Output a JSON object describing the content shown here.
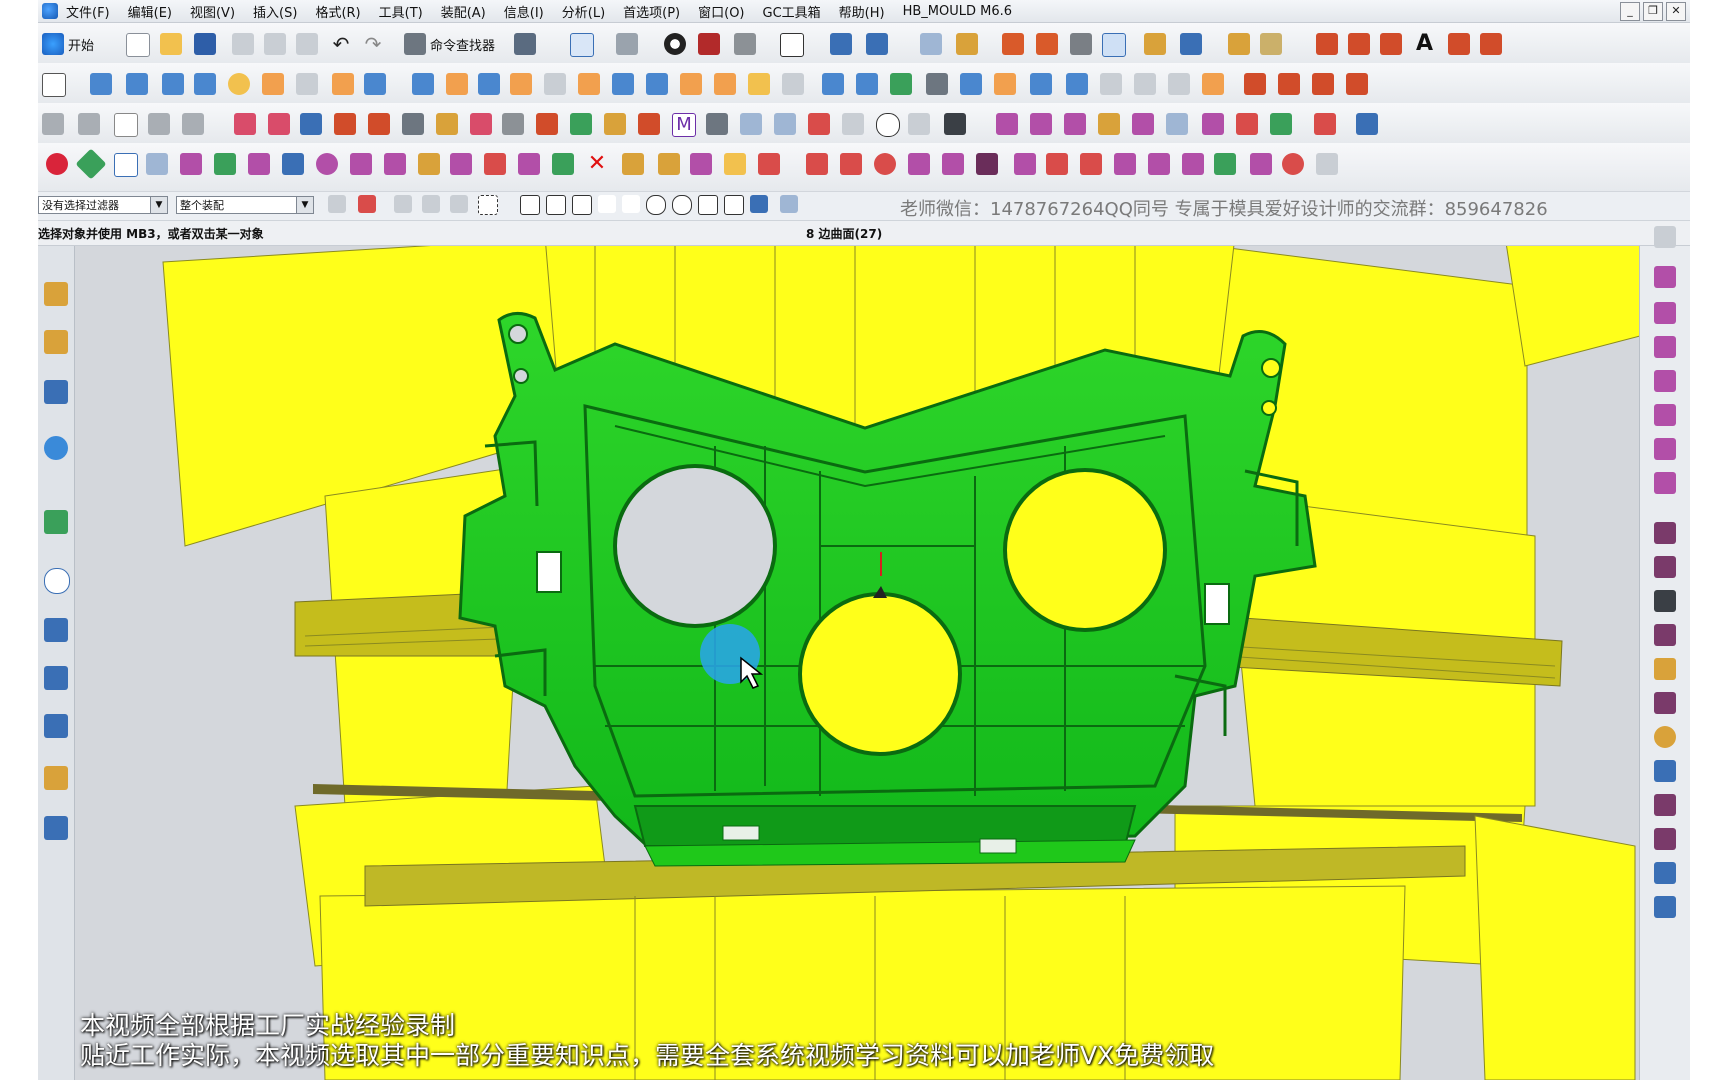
{
  "menubar": {
    "items": [
      "文件(F)",
      "编辑(E)",
      "视图(V)",
      "插入(S)",
      "格式(R)",
      "工具(T)",
      "装配(A)",
      "信息(I)",
      "分析(L)",
      "首选项(P)",
      "窗口(O)",
      "GC工具箱",
      "帮助(H)",
      "HB_MOULD M6.6"
    ]
  },
  "window_controls": {
    "minimize": "_",
    "restore": "❐",
    "close": "✕"
  },
  "toolbar": {
    "start_label": "开始",
    "command_finder_label": "命令查找器",
    "text_tool": "A"
  },
  "selection_bar": {
    "filter_value": "没有选择过滤器",
    "scope_value": "整个装配",
    "banner_text": "老师微信：1478767264QQ同号 专属于模具爱好设计师的交流群：859647826"
  },
  "status": {
    "cue": "选择对象并使用 MB3，或者双击某一对象",
    "selection_info": "8 边曲面(27)"
  },
  "captions": {
    "line1": "本视频全部根据工厂实战经验录制",
    "line2": "贴近工作实际，本视频选取其中一部分重要知识点，需要全套系统视频学习资料可以加老师VX免费领取"
  },
  "colors": {
    "part_green": "#14c21a",
    "surface_yellow": "#ffff1a",
    "background_grey": "#d4d7dc",
    "highlight_blue": "#29a4ef"
  },
  "icons": {
    "left_resource_bar": [
      "assembly-navigator-icon",
      "constraint-navigator-icon",
      "part-navigator-icon",
      "reuse-library-icon",
      "web-browser-icon",
      "history-icon",
      "system-materials-icon",
      "process-studio-icon",
      "manikin-icon",
      "roles-icon",
      "system-scenes-icon"
    ],
    "right_mold_bar": [
      "mold-wizard-project-icon",
      "workpiece-icon",
      "mold-csys-icon",
      "shrinkage-icon",
      "layout-icon",
      "parting-tools-icon",
      "mold-base-icon",
      "standard-part-icon",
      "ejector-pin-icon",
      "slider-lifter-icon",
      "sub-insert-icon",
      "gate-icon",
      "runner-icon",
      "cooling-icon",
      "electrode-icon",
      "trim-icon",
      "pocket-icon",
      "bill-of-material-icon",
      "drawing-icon"
    ]
  }
}
